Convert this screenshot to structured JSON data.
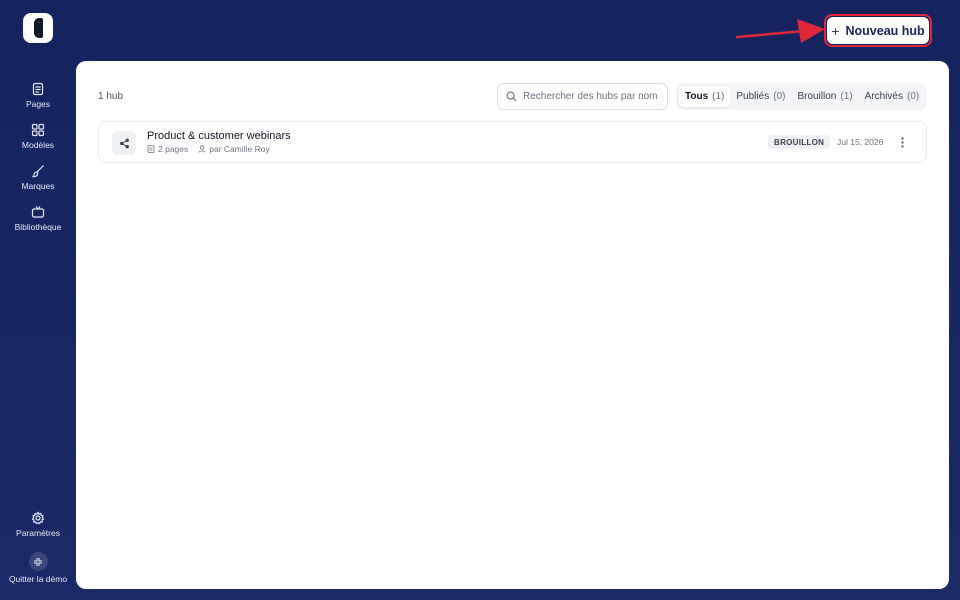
{
  "header": {
    "new_hub_label": "Nouveau hub",
    "new_hub_plus": "+"
  },
  "sidebar": {
    "items": [
      {
        "label": "Pages",
        "icon": "pages-icon"
      },
      {
        "label": "Modèles",
        "icon": "grid-icon"
      },
      {
        "label": "Marques",
        "icon": "brush-icon"
      },
      {
        "label": "Bibliothèque",
        "icon": "tv-icon"
      }
    ],
    "settings_label": "Paramètres",
    "quit_label": "Quitter la démo"
  },
  "main": {
    "count": "1 hub",
    "search": {
      "placeholder": "Rechercher des hubs par nom",
      "value": ""
    },
    "tabs": [
      {
        "label": "Tous",
        "count": "(1)",
        "active": true
      },
      {
        "label": "Publiés",
        "count": "(0)",
        "active": false
      },
      {
        "label": "Brouillon",
        "count": "(1)",
        "active": false
      },
      {
        "label": "Archivés",
        "count": "(0)",
        "active": false
      }
    ],
    "hubs": [
      {
        "title": "Product & customer webinars",
        "pages": "2 pages",
        "author": "par Camille Roy",
        "status": "BROUILLON",
        "date": "Jul 15, 2026"
      }
    ]
  },
  "colors": {
    "background": "#15245e",
    "accent": "#15245e",
    "highlight": "#e0283a"
  }
}
